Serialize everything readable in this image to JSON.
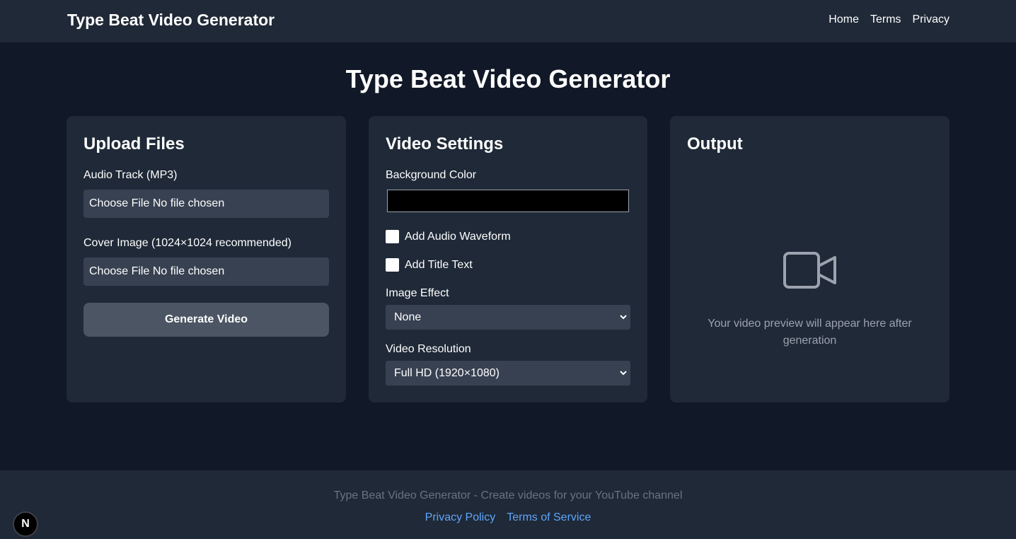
{
  "header": {
    "brand": "Type Beat Video Generator",
    "nav": [
      "Home",
      "Terms",
      "Privacy"
    ]
  },
  "page_title": "Type Beat Video Generator",
  "upload": {
    "title": "Upload Files",
    "audio_label": "Audio Track (MP3)",
    "audio_input": "Choose File No file chosen",
    "cover_label": "Cover Image (1024×1024 recommended)",
    "cover_input": "Choose File No file chosen",
    "generate_label": "Generate Video"
  },
  "settings": {
    "title": "Video Settings",
    "bg_color_label": "Background Color",
    "bg_color_value": "#000000",
    "waveform_label": "Add Audio Waveform",
    "waveform_checked": false,
    "title_text_label": "Add Title Text",
    "title_text_checked": false,
    "image_effect_label": "Image Effect",
    "image_effect_value": "None",
    "resolution_label": "Video Resolution",
    "resolution_value": "Full HD (1920×1080)"
  },
  "output": {
    "title": "Output",
    "icon": "video-camera-icon",
    "preview_text": "Your video preview will appear here after generation"
  },
  "footer": {
    "text": "Type Beat Video Generator - Create videos for your YouTube channel",
    "links": [
      "Privacy Policy",
      "Terms of Service"
    ]
  },
  "dev_badge": "N",
  "colors": {
    "page_bg": "#111827",
    "card_bg": "#1f2937",
    "input_bg": "#374151",
    "button_bg": "#4b5563",
    "muted_text": "#9ca3af",
    "link": "#60a5fa"
  }
}
